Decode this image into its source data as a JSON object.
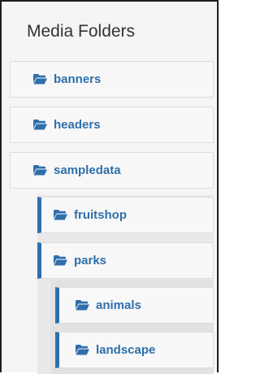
{
  "panel": {
    "title": "Media Folders"
  },
  "colors": {
    "accent": "#2f6fab",
    "panel_background": "#f5f5f5",
    "item_background": "#f8f8f8",
    "nested_background": "#e9e9e9"
  },
  "folders": [
    {
      "label": "banners",
      "icon": "folder-open-icon"
    },
    {
      "label": "headers",
      "icon": "folder-open-icon"
    },
    {
      "label": "sampledata",
      "icon": "folder-open-icon"
    },
    {
      "label": "fruitshop",
      "icon": "folder-open-icon"
    },
    {
      "label": "parks",
      "icon": "folder-open-icon"
    },
    {
      "label": "animals",
      "icon": "folder-open-icon"
    },
    {
      "label": "landscape",
      "icon": "folder-open-icon"
    }
  ]
}
